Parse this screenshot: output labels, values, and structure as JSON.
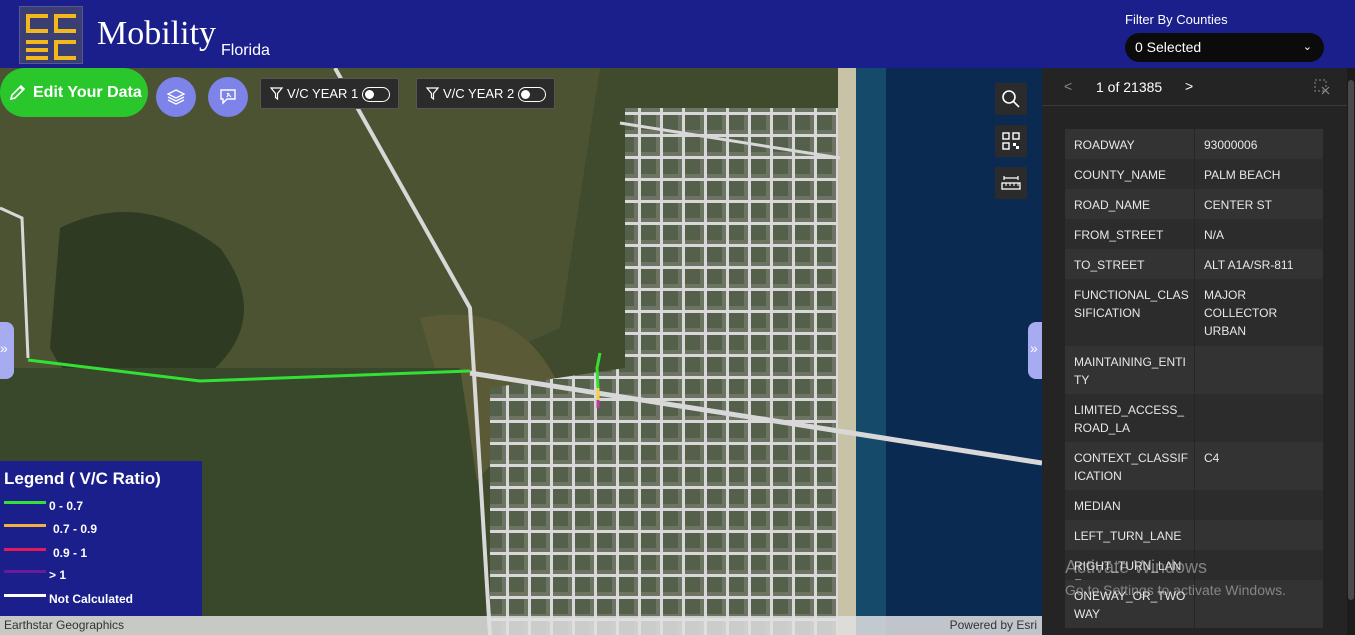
{
  "header": {
    "app_title": "Mobility",
    "app_subtitle": "Florida",
    "logo_icon": "ddec-logo",
    "filter_label": "Filter By Counties",
    "county_select_value": "0 Selected",
    "brand_color": "#1a1f8c"
  },
  "toolbar": {
    "edit_label": "Edit Your Data",
    "edit_color": "#29c72c",
    "layers_icon": "layers-icon",
    "feedback_icon": "feedback-icon",
    "filter_year1_label": "V/C YEAR 1",
    "filter_year2_label": "V/C YEAR 2",
    "filter_year1_on": false,
    "filter_year2_on": false
  },
  "map_tools": [
    "search-icon",
    "qr-code-icon",
    "measure-icon"
  ],
  "legend": {
    "title": "Legend ( V/C Ratio)",
    "items": [
      {
        "label": "0 - 0.7",
        "color": "#33e033"
      },
      {
        "label": "0.7 - 0.9",
        "color": "#f2b040"
      },
      {
        "label": "0.9 - 1",
        "color": "#e8195a"
      },
      {
        "label": "> 1",
        "color": "#6a1a9a"
      },
      {
        "label": "Not Calculated",
        "color": "#ffffff"
      }
    ]
  },
  "attribution": {
    "left": "Earthstar Geographics",
    "right": "Powered by Esri"
  },
  "panel": {
    "pager_prev": "<",
    "pager_text": "1 of 21385",
    "pager_next": ">",
    "select_icon": "select-close-icon",
    "attributes": [
      {
        "key": "ROADWAY",
        "value": "93000006"
      },
      {
        "key": "COUNTY_NAME",
        "value": "PALM BEACH"
      },
      {
        "key": "ROAD_NAME",
        "value": "CENTER ST"
      },
      {
        "key": "FROM_STREET",
        "value": "N/A"
      },
      {
        "key": "TO_STREET",
        "value": "ALT A1A/SR-811"
      },
      {
        "key": "FUNCTIONAL_CLASSIFICATION",
        "value": "MAJOR COLLECTOR URBAN"
      },
      {
        "key": "MAINTAINING_ENTITY",
        "value": ""
      },
      {
        "key": "LIMITED_ACCESS_ROAD_LA",
        "value": ""
      },
      {
        "key": "CONTEXT_CLASSIFICATION",
        "value": "C4"
      },
      {
        "key": "MEDIAN",
        "value": ""
      },
      {
        "key": "LEFT_TURN_LANE",
        "value": ""
      },
      {
        "key": "RIGHT_TURN_LANE",
        "value": ""
      },
      {
        "key": "ONEWAY_OR_TWOWAY",
        "value": ""
      }
    ]
  },
  "watermark": {
    "line1": "Activate Windows",
    "line2": "Go to Settings to activate Windows."
  }
}
